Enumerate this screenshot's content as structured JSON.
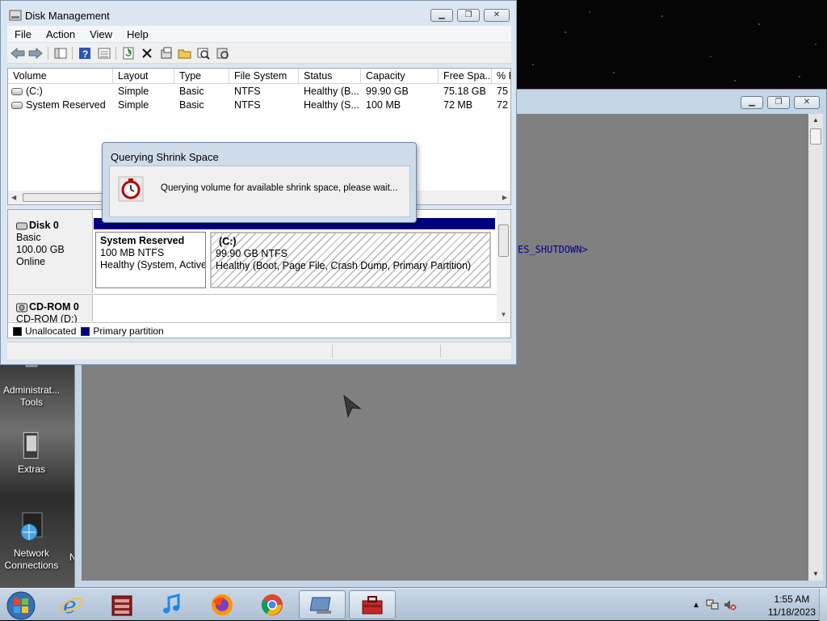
{
  "desktop": {
    "icons": [
      {
        "label": "Administrat... Tools",
        "icon": "admin-tools-icon"
      },
      {
        "label": "Extras",
        "icon": "extras-folder-icon"
      },
      {
        "label": "Network Connections",
        "icon": "network-connections-icon"
      }
    ],
    "edge_letter": "N"
  },
  "bg_window": {
    "console_text": "ES_SHUTDOWN>"
  },
  "disk_management": {
    "title": "Disk Management",
    "menu": [
      "File",
      "Action",
      "View",
      "Help"
    ],
    "toolbar_icons": [
      "back-icon",
      "forward-icon",
      "properties-pane-icon",
      "help-icon",
      "list-view-icon",
      "refresh-icon",
      "delete-icon",
      "properties-icon",
      "open-icon",
      "explore-icon",
      "rescan-icon"
    ],
    "columns": [
      "Volume",
      "Layout",
      "Type",
      "File System",
      "Status",
      "Capacity",
      "Free Spa...",
      "% F"
    ],
    "volumes": [
      {
        "volume": "(C:)",
        "layout": "Simple",
        "type": "Basic",
        "fs": "NTFS",
        "status": "Healthy (B...",
        "capacity": "99.90 GB",
        "free": "75.18 GB",
        "pct": "75"
      },
      {
        "volume": "System Reserved",
        "layout": "Simple",
        "type": "Basic",
        "fs": "NTFS",
        "status": "Healthy (S...",
        "capacity": "100 MB",
        "free": "72 MB",
        "pct": "72"
      }
    ],
    "disk0": {
      "name": "Disk 0",
      "type": "Basic",
      "size": "100.00 GB",
      "state": "Online",
      "partitions": [
        {
          "name": "System Reserved",
          "size": "100 MB NTFS",
          "status": "Healthy (System, Active, Primary Partition)"
        },
        {
          "name": "(C:)",
          "size": "99.90 GB NTFS",
          "status": "Healthy (Boot, Page File, Crash Dump, Primary Partition)"
        }
      ]
    },
    "cdrom": {
      "name": "CD-ROM 0",
      "drive": "CD-ROM (D:)"
    },
    "legend": [
      {
        "label": "Unallocated",
        "color": "#000000"
      },
      {
        "label": "Primary partition",
        "color": "#00007f"
      }
    ]
  },
  "dialog": {
    "title": "Querying Shrink Space",
    "message": "Querying volume for available shrink space, please wait...",
    "icon": "stopwatch-icon"
  },
  "taskbar": {
    "apps": [
      "internet-explorer-icon",
      "archive-icon",
      "itunes-icon",
      "firefox-icon",
      "chrome-icon",
      "disk-management-icon",
      "toolbox-icon"
    ],
    "clock_time": "1:55 AM",
    "clock_date": "11/18/2023"
  }
}
